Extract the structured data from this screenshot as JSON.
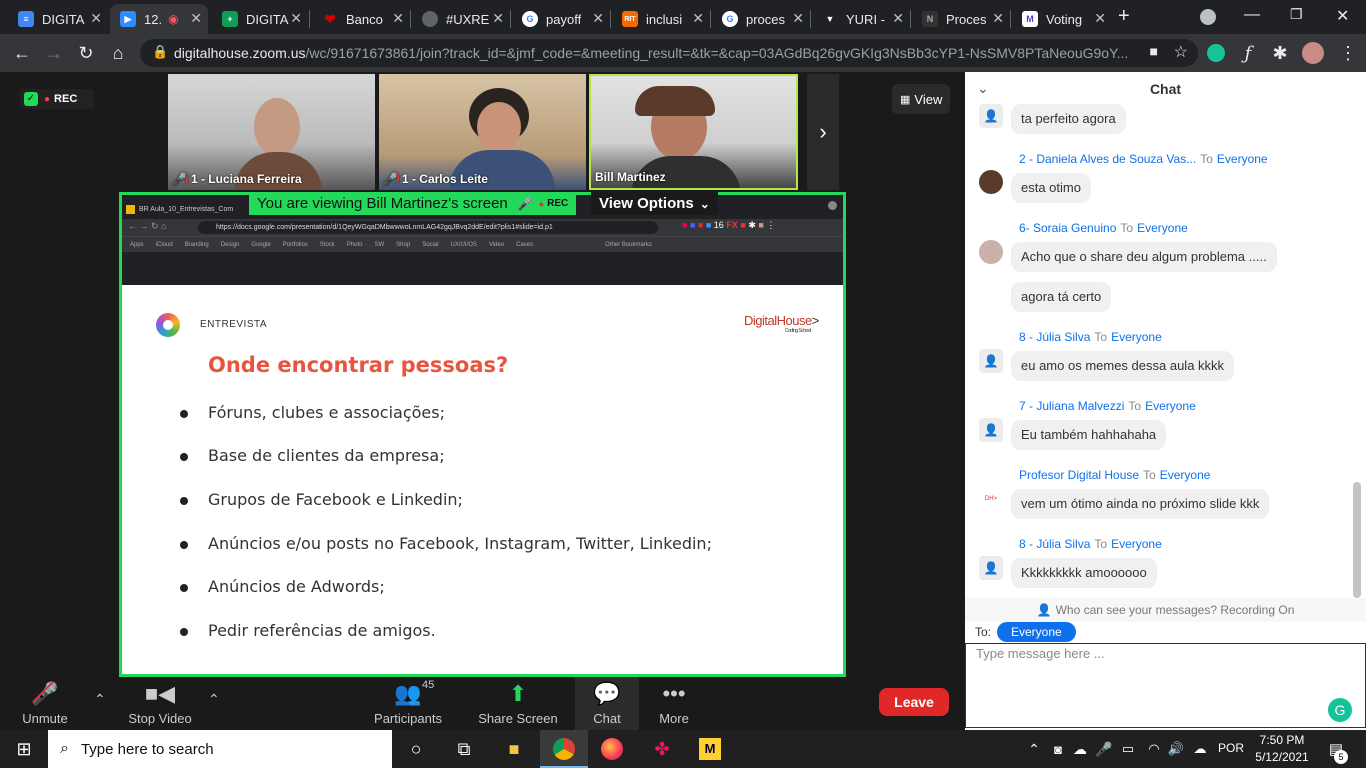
{
  "browser": {
    "tabs": [
      {
        "label": "DIGITA",
        "icon": "docs-icon",
        "color": "#4285f4"
      },
      {
        "label": "12.",
        "icon": "zoom-icon",
        "color": "#2d8cff"
      },
      {
        "label": "DIGITA",
        "icon": "sheets-icon",
        "color": "#0f9d58"
      },
      {
        "label": "Banco",
        "icon": "bank-icon",
        "color": "#cc0000"
      },
      {
        "label": "#UXRE",
        "icon": "globe-icon",
        "color": "#888888"
      },
      {
        "label": "payoff",
        "icon": "google-icon",
        "color": "#ffffff"
      },
      {
        "label": "inclusi",
        "icon": "rit-icon",
        "color": "#f76902"
      },
      {
        "label": "proces",
        "icon": "google-icon",
        "color": "#ffffff"
      },
      {
        "label": "YURI -",
        "icon": "shield-icon",
        "color": "#333333"
      },
      {
        "label": "Proces",
        "icon": "notion-icon",
        "color": "#555555"
      },
      {
        "label": "Voting",
        "icon": "gmail-icon",
        "color": "#ffffff"
      }
    ],
    "url_host": "digitalhouse.zoom.us",
    "url_path": "/wc/91671673861/join?track_id=&jmf_code=&meeting_result=&tk=&cap=03AGdBq26gvGKIg3NsBb3cYP1-NsSMV8PTaNeouG9oY..."
  },
  "meeting": {
    "rec_label": "REC",
    "view_label": "View",
    "participants": [
      {
        "name": "1 - Luciana Ferreira",
        "muted": true
      },
      {
        "name": "1 - Carlos Leite",
        "muted": true
      },
      {
        "name": "Bill Martinez",
        "muted": false
      }
    ],
    "banner_text": "You are viewing Bill Martinez's screen",
    "banner_rec": "REC",
    "view_options": "View Options"
  },
  "shared_screen": {
    "inner_tab": "BR Aula_10_Entrevistas_Com",
    "inner_url": "https://docs.google.com/presentation/d/1QeyWGqaDMbwwwoLnmLAG42gqJBvq2ddE/edit?plis1#slide=id.p1",
    "bookmarks": [
      "Apps",
      "iCloud",
      "Branding",
      "Design",
      "Google",
      "Portfolios",
      "Stock",
      "Photo",
      "SW",
      "Shop",
      "Social",
      "UX/UI/OS",
      "Video",
      "Cases",
      "Other Bookmarks"
    ],
    "slide_label": "ENTREVISTA",
    "slide_brand": "DigitalHouse",
    "slide_brand_sub": "Coding School",
    "slide_title": "Onde encontrar pessoas?",
    "bullets": [
      "Fóruns, clubes e associações;",
      "Base de clientes da empresa;",
      "Grupos de Facebook e Linkedin;",
      "Anúncios e/ou posts no Facebook, Instagram, Twitter, Linkedin;",
      "Anúncios de Adwords;",
      "Pedir referências de amigos."
    ]
  },
  "toolbar": {
    "unmute": "Unmute",
    "stop_video": "Stop Video",
    "participants": "Participants",
    "participants_count": "45",
    "share_screen": "Share Screen",
    "chat": "Chat",
    "more": "More",
    "leave": "Leave"
  },
  "chat": {
    "title": "Chat",
    "messages": [
      {
        "sender": "",
        "to": "",
        "text": "ta perfeito agora"
      },
      {
        "sender": "2 - Daniela Alves de Souza Vas...",
        "to": "Everyone",
        "text": "esta otimo"
      },
      {
        "sender": "6- Soraia Genuino",
        "to": "Everyone",
        "text": "Acho que o share deu algum problema ....."
      },
      {
        "sender": "",
        "to": "",
        "text": "agora tá certo"
      },
      {
        "sender": "8 - Júlia Silva",
        "to": "Everyone",
        "text": "eu amo os memes dessa aula kkkk"
      },
      {
        "sender": "7 - Juliana Malvezzi",
        "to": "Everyone",
        "text": "Eu também hahhahaha"
      },
      {
        "sender": "Profesor Digital House",
        "to": "Everyone",
        "text": "vem um ótimo ainda no próximo slide kkk"
      },
      {
        "sender": "8 - Júlia Silva",
        "to": "Everyone",
        "text": "Kkkkkkkkk amoooooo"
      }
    ],
    "to_word": "To",
    "who_can_see": "Who can see your messages? Recording On",
    "to_label": "To:",
    "to_target": "Everyone",
    "input_placeholder": "Type message here ..."
  },
  "taskbar": {
    "search_placeholder": "Type here to search",
    "lang": "POR",
    "time": "7:50 PM",
    "date": "5/12/2021",
    "notification_count": "5"
  }
}
